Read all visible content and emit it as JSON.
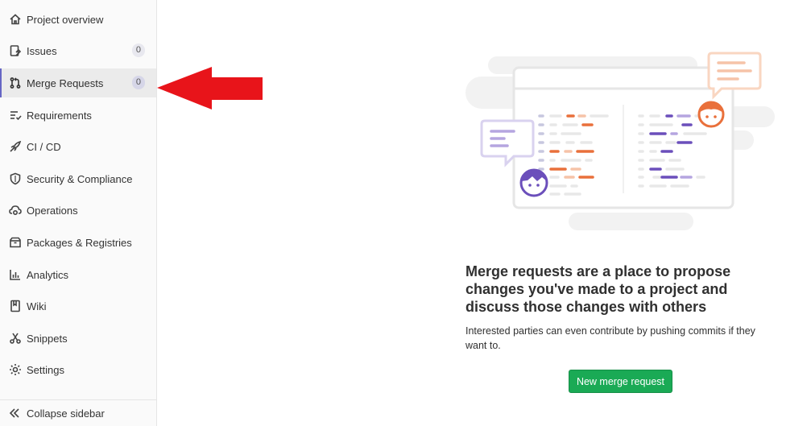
{
  "sidebar": {
    "items": [
      {
        "label": "Project overview",
        "icon": "home-icon"
      },
      {
        "label": "Issues",
        "icon": "issues-icon",
        "badge": "0"
      },
      {
        "label": "Merge Requests",
        "icon": "merge-request-icon",
        "badge": "0",
        "active": true
      },
      {
        "label": "Requirements",
        "icon": "requirements-icon"
      },
      {
        "label": "CI / CD",
        "icon": "rocket-icon"
      },
      {
        "label": "Security & Compliance",
        "icon": "shield-icon"
      },
      {
        "label": "Operations",
        "icon": "cloud-gear-icon"
      },
      {
        "label": "Packages & Registries",
        "icon": "package-icon"
      },
      {
        "label": "Analytics",
        "icon": "chart-icon"
      },
      {
        "label": "Wiki",
        "icon": "book-icon"
      },
      {
        "label": "Snippets",
        "icon": "scissors-icon"
      },
      {
        "label": "Settings",
        "icon": "gear-icon"
      }
    ],
    "collapse_label": "Collapse sidebar"
  },
  "empty_state": {
    "title": "Merge requests are a place to propose changes you've made to a project and discuss those changes with others",
    "description": "Interested parties can even contribute by pushing commits if they want to.",
    "button_label": "New merge request"
  },
  "colors": {
    "active_accent": "#6666c4",
    "button_green": "#1aaa55",
    "annotation_arrow": "#e8141a",
    "illustration_purple": "#6b4fbb",
    "illustration_orange": "#e9703b"
  }
}
